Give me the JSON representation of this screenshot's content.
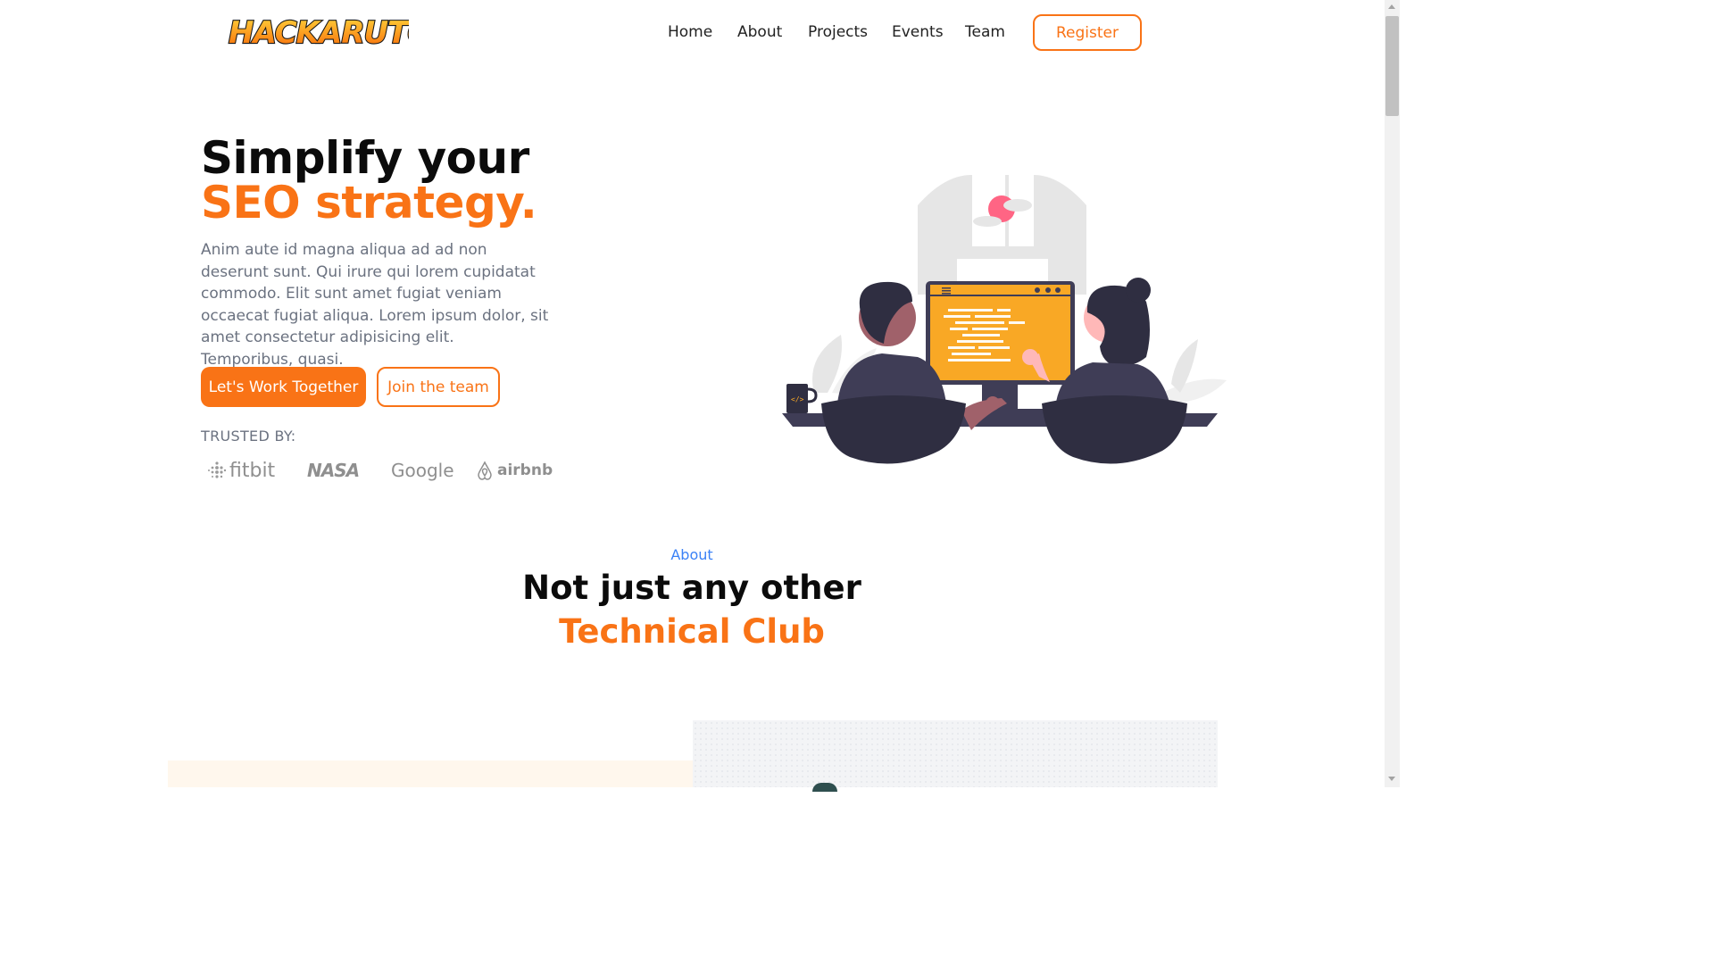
{
  "logo": {
    "text": "HACKARUTO"
  },
  "nav": {
    "items": [
      "Home",
      "About",
      "Projects",
      "Events",
      "Team"
    ],
    "register_label": "Register"
  },
  "hero": {
    "title_line1": "Simplify your",
    "title_line2": "SEO strategy.",
    "description": "Anim aute id magna aliqua ad ad non deserunt sunt. Qui irure qui lorem cupidatat commodo. Elit sunt amet fugiat veniam occaecat fugiat aliqua. Lorem ipsum dolor, sit amet consectetur adipisicing elit. Temporibus, quasi.",
    "primary_button": "Let's Work Together",
    "secondary_button": "Join the team",
    "trusted_label": "TRUSTED BY:",
    "brands": [
      "fitbit",
      "NASA",
      "Google",
      "airbnb"
    ]
  },
  "about": {
    "kicker": "About",
    "title_line1": "Not just any other",
    "title_line2": "Technical Club"
  },
  "colors": {
    "accent": "#f97316",
    "link_blue": "#3b82f6",
    "text_muted": "#6b7280",
    "monitor": "#f9a825",
    "dark_figure": "#2f2e41"
  }
}
